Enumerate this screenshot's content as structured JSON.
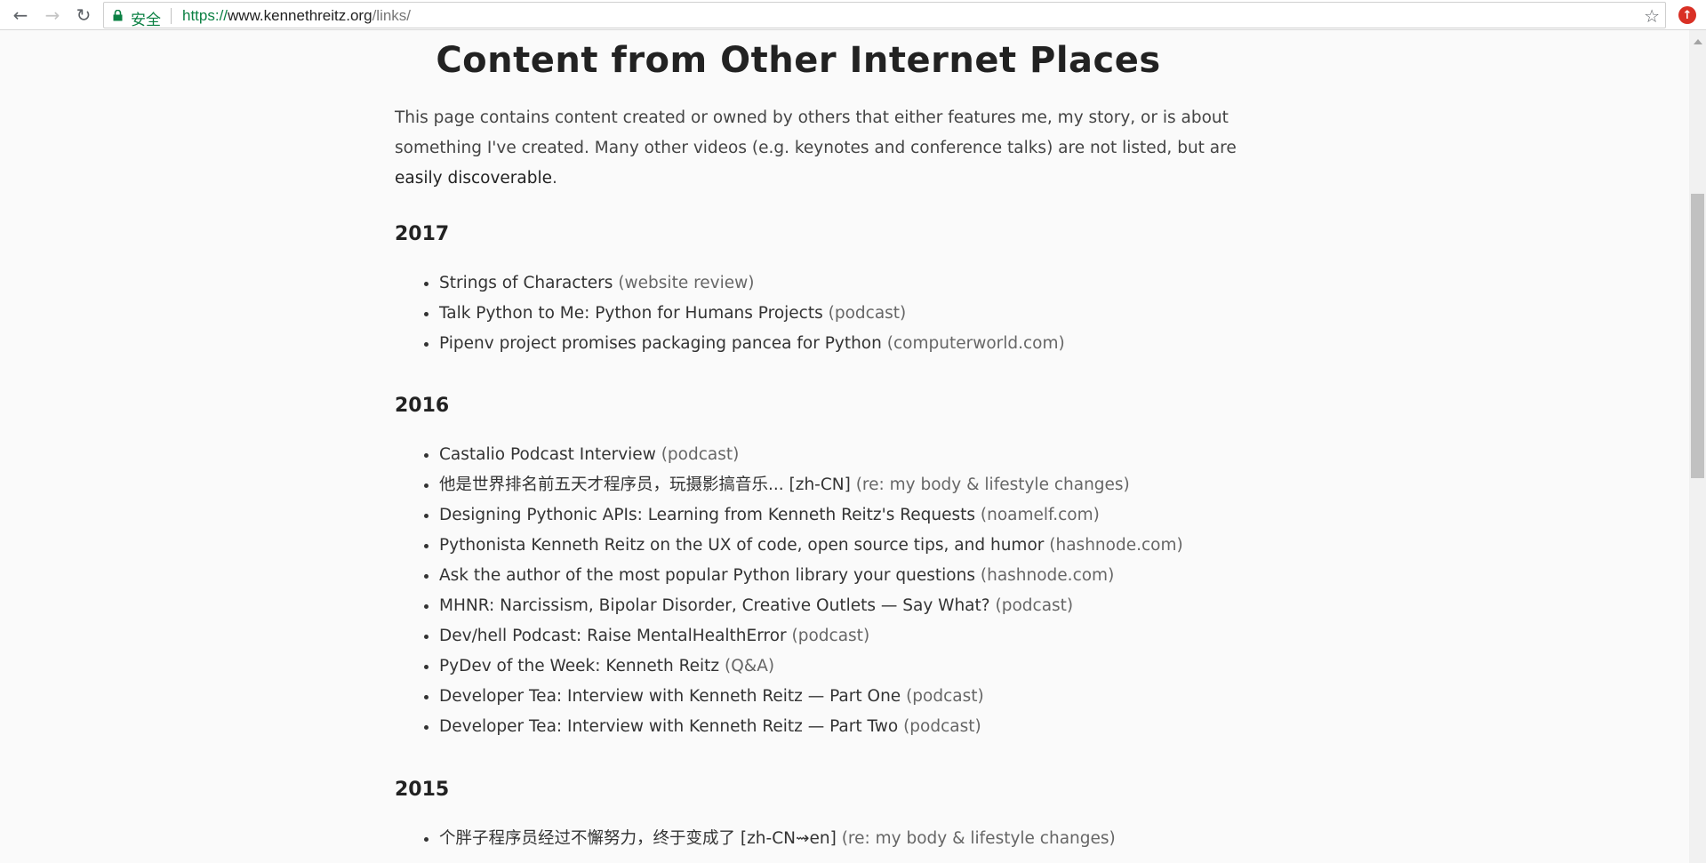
{
  "browser": {
    "secure_label": "安全",
    "url_scheme": "https://",
    "url_host": "www.kennethreitz.org",
    "url_path": "/links/",
    "back_icon": "←",
    "forward_icon": "→",
    "reload_icon": "↻",
    "star_icon": "☆",
    "ext_icon": "↑",
    "accent_color": "#0b8043"
  },
  "page": {
    "title": "Content from Other Internet Places",
    "intro_main": "This page contains content created or owned by others that either features me, my story, or is about something I've created. Many other videos (e.g. keynotes and conference talks) are not listed, but are ",
    "intro_link": "easily discoverable",
    "intro_end": "."
  },
  "sections": [
    {
      "year": "2017",
      "items": [
        {
          "title": "Strings of Characters",
          "tag": "(website review)"
        },
        {
          "title": "Talk Python to Me: Python for Humans Projects",
          "tag": "(podcast)"
        },
        {
          "title": "Pipenv project promises packaging pancea for Python",
          "tag": "(computerworld.com)"
        }
      ]
    },
    {
      "year": "2016",
      "items": [
        {
          "title": "Castalio Podcast Interview",
          "tag": "(podcast)"
        },
        {
          "title": "他是世界排名前五天才程序员，玩摄影搞音乐... [zh-CN]",
          "tag": "(re: my body & lifestyle changes)"
        },
        {
          "title": "Designing Pythonic APIs: Learning from Kenneth Reitz's Requests",
          "tag": "(noamelf.com)"
        },
        {
          "title": "Pythonista Kenneth Reitz on the UX of code, open source tips, and humor",
          "tag": "(hashnode.com)"
        },
        {
          "title": "Ask the author of the most popular Python library your questions",
          "tag": "(hashnode.com)"
        },
        {
          "title": "MHNR: Narcissism, Bipolar Disorder, Creative Outlets — Say What?",
          "tag": "(podcast)"
        },
        {
          "title": "Dev/hell Podcast: Raise MentalHealthError",
          "tag": "(podcast)"
        },
        {
          "title": "PyDev of the Week: Kenneth Reitz",
          "tag": "(Q&A)"
        },
        {
          "title": "Developer Tea: Interview with Kenneth Reitz — Part One",
          "tag": "(podcast)"
        },
        {
          "title": "Developer Tea: Interview with Kenneth Reitz — Part Two",
          "tag": "(podcast)"
        }
      ]
    },
    {
      "year": "2015",
      "items": [
        {
          "title": "个胖子程序员经过不懈努力，终于变成了 [zh-CN⇝en]",
          "tag": "(re: my body & lifestyle changes)"
        }
      ]
    }
  ]
}
